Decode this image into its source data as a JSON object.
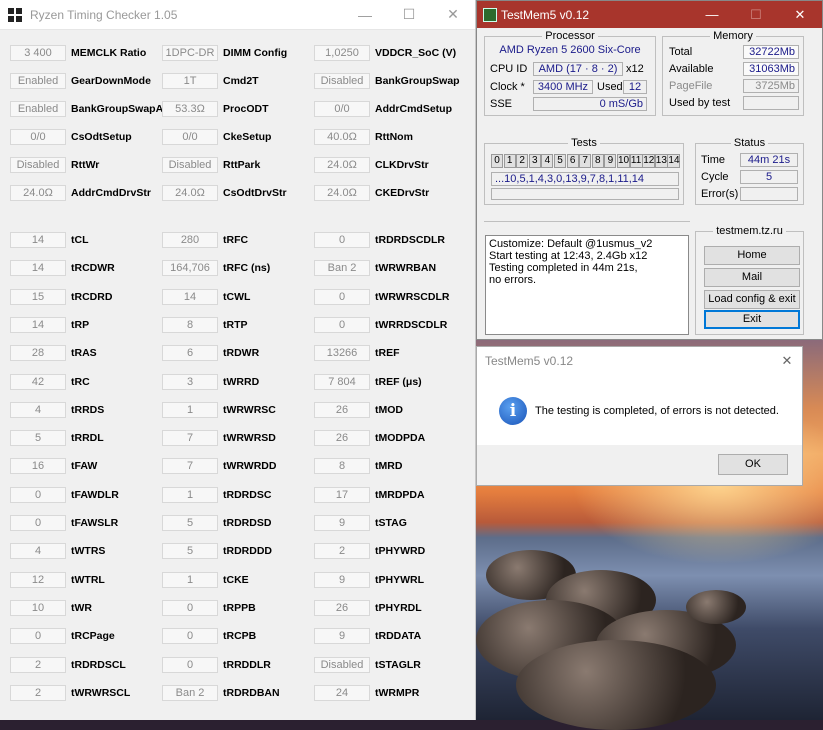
{
  "rtc": {
    "title": "Ryzen Timing Checker 1.05",
    "col1": [
      {
        "value": "3 400",
        "label": "MEMCLK Ratio"
      },
      {
        "value": "Enabled",
        "label": "GearDownMode"
      },
      {
        "value": "Enabled",
        "label": "BankGroupSwapAlt"
      },
      {
        "value": "0/0",
        "label": "CsOdtSetup"
      },
      {
        "value": "Disabled",
        "label": "RttWr"
      },
      {
        "value": "24.0Ω",
        "label": "AddrCmdDrvStr"
      },
      {
        "value": "14",
        "label": "tCL"
      },
      {
        "value": "14",
        "label": "tRCDWR"
      },
      {
        "value": "15",
        "label": "tRCDRD"
      },
      {
        "value": "14",
        "label": "tRP"
      },
      {
        "value": "28",
        "label": "tRAS"
      },
      {
        "value": "42",
        "label": "tRC"
      },
      {
        "value": "4",
        "label": "tRRDS"
      },
      {
        "value": "5",
        "label": "tRRDL"
      },
      {
        "value": "16",
        "label": "tFAW"
      },
      {
        "value": "0",
        "label": "tFAWDLR"
      },
      {
        "value": "0",
        "label": "tFAWSLR"
      },
      {
        "value": "4",
        "label": "tWTRS"
      },
      {
        "value": "12",
        "label": "tWTRL"
      },
      {
        "value": "10",
        "label": "tWR"
      },
      {
        "value": "0",
        "label": "tRCPage"
      },
      {
        "value": "2",
        "label": "tRDRDSCL"
      },
      {
        "value": "2",
        "label": "tWRWRSCL"
      }
    ],
    "col2": [
      {
        "value": "1DPC-DR",
        "label": "DIMM Config"
      },
      {
        "value": "1T",
        "label": "Cmd2T"
      },
      {
        "value": "53.3Ω",
        "label": "ProcODT"
      },
      {
        "value": "0/0",
        "label": "CkeSetup"
      },
      {
        "value": "Disabled",
        "label": "RttPark"
      },
      {
        "value": "24.0Ω",
        "label": "CsOdtDrvStr"
      },
      {
        "value": "280",
        "label": "tRFC"
      },
      {
        "value": "164,706",
        "label": "tRFC (ns)"
      },
      {
        "value": "14",
        "label": "tCWL"
      },
      {
        "value": "8",
        "label": "tRTP"
      },
      {
        "value": "6",
        "label": "tRDWR"
      },
      {
        "value": "3",
        "label": "tWRRD"
      },
      {
        "value": "1",
        "label": "tWRWRSC"
      },
      {
        "value": "7",
        "label": "tWRWRSD"
      },
      {
        "value": "7",
        "label": "tWRWRDD"
      },
      {
        "value": "1",
        "label": "tRDRDSC"
      },
      {
        "value": "5",
        "label": "tRDRDSD"
      },
      {
        "value": "5",
        "label": "tRDRDDD"
      },
      {
        "value": "1",
        "label": "tCKE"
      },
      {
        "value": "0",
        "label": "tRPPB"
      },
      {
        "value": "0",
        "label": "tRCPB"
      },
      {
        "value": "0",
        "label": "tRRDDLR"
      },
      {
        "value": "Ban 2",
        "label": "tRDRDBAN"
      }
    ],
    "col3": [
      {
        "value": "1,0250",
        "label": "VDDCR_SoC (V)"
      },
      {
        "value": "Disabled",
        "label": "BankGroupSwap"
      },
      {
        "value": "0/0",
        "label": "AddrCmdSetup"
      },
      {
        "value": "40.0Ω",
        "label": "RttNom"
      },
      {
        "value": "24.0Ω",
        "label": "CLKDrvStr"
      },
      {
        "value": "24.0Ω",
        "label": "CKEDrvStr"
      },
      {
        "value": "0",
        "label": "tRDRDSCDLR"
      },
      {
        "value": "Ban 2",
        "label": "tWRWRBAN"
      },
      {
        "value": "0",
        "label": "tWRWRSCDLR"
      },
      {
        "value": "0",
        "label": "tWRRDSCDLR"
      },
      {
        "value": "13266",
        "label": "tREF"
      },
      {
        "value": "7 804",
        "label": "tREF (μs)"
      },
      {
        "value": "26",
        "label": "tMOD"
      },
      {
        "value": "26",
        "label": "tMODPDA"
      },
      {
        "value": "8",
        "label": "tMRD"
      },
      {
        "value": "17",
        "label": "tMRDPDA"
      },
      {
        "value": "9",
        "label": "tSTAG"
      },
      {
        "value": "2",
        "label": "tPHYWRD"
      },
      {
        "value": "9",
        "label": "tPHYWRL"
      },
      {
        "value": "26",
        "label": "tPHYRDL"
      },
      {
        "value": "9",
        "label": "tRDDATA"
      },
      {
        "value": "Disabled",
        "label": "tSTAGLR"
      },
      {
        "value": "24",
        "label": "tWRMPR"
      }
    ]
  },
  "tm5": {
    "title": "TestMem5 v0.12",
    "processor": {
      "title": "Processor",
      "name": "AMD Ryzen 5 2600 Six-Core",
      "cpuid_label": "CPU ID",
      "cpuid": "AMD  (17 · 8 · 2)",
      "threads": "x12",
      "clock_label": "Clock *",
      "clock": "3400 MHz",
      "used_label": "Used",
      "used": "12",
      "sse_label": "SSE",
      "sse": "0 mS/Gb"
    },
    "memory": {
      "title": "Memory",
      "total_label": "Total",
      "total": "32722Mb",
      "available_label": "Available",
      "available": "31063Mb",
      "pagefile_label": "PageFile",
      "pagefile": "3725Mb",
      "usedbytest_label": "Used by test",
      "usedbytest": ""
    },
    "tests": {
      "title": "Tests",
      "numbers": [
        "0",
        "1",
        "2",
        "3",
        "4",
        "5",
        "6",
        "7",
        "8",
        "9",
        "10",
        "11",
        "12",
        "13",
        "14"
      ],
      "sequence": "...10,5,1,4,3,0,13,9,7,8,1,11,14"
    },
    "status": {
      "title": "Status",
      "time_label": "Time",
      "time": "44m 21s",
      "cycle_label": "Cycle",
      "cycle": "5",
      "errors_label": "Error(s)",
      "errors": ""
    },
    "log": [
      "Customize: Default @1usmus_v2",
      "Start testing at 12:43, 2.4Gb x12",
      "Testing completed in 44m 21s,",
      "no errors."
    ],
    "site": {
      "title": "testmem.tz.ru",
      "home": "Home",
      "mail": "Mail",
      "load": "Load config & exit",
      "exit": "Exit"
    }
  },
  "dialog": {
    "title": "TestMem5 v0.12",
    "message": "The testing is completed, of errors is not detected.",
    "ok": "OK"
  },
  "colors": {
    "tm5_titlebar": "#a8352c",
    "field_text": "#1a1a8a"
  }
}
